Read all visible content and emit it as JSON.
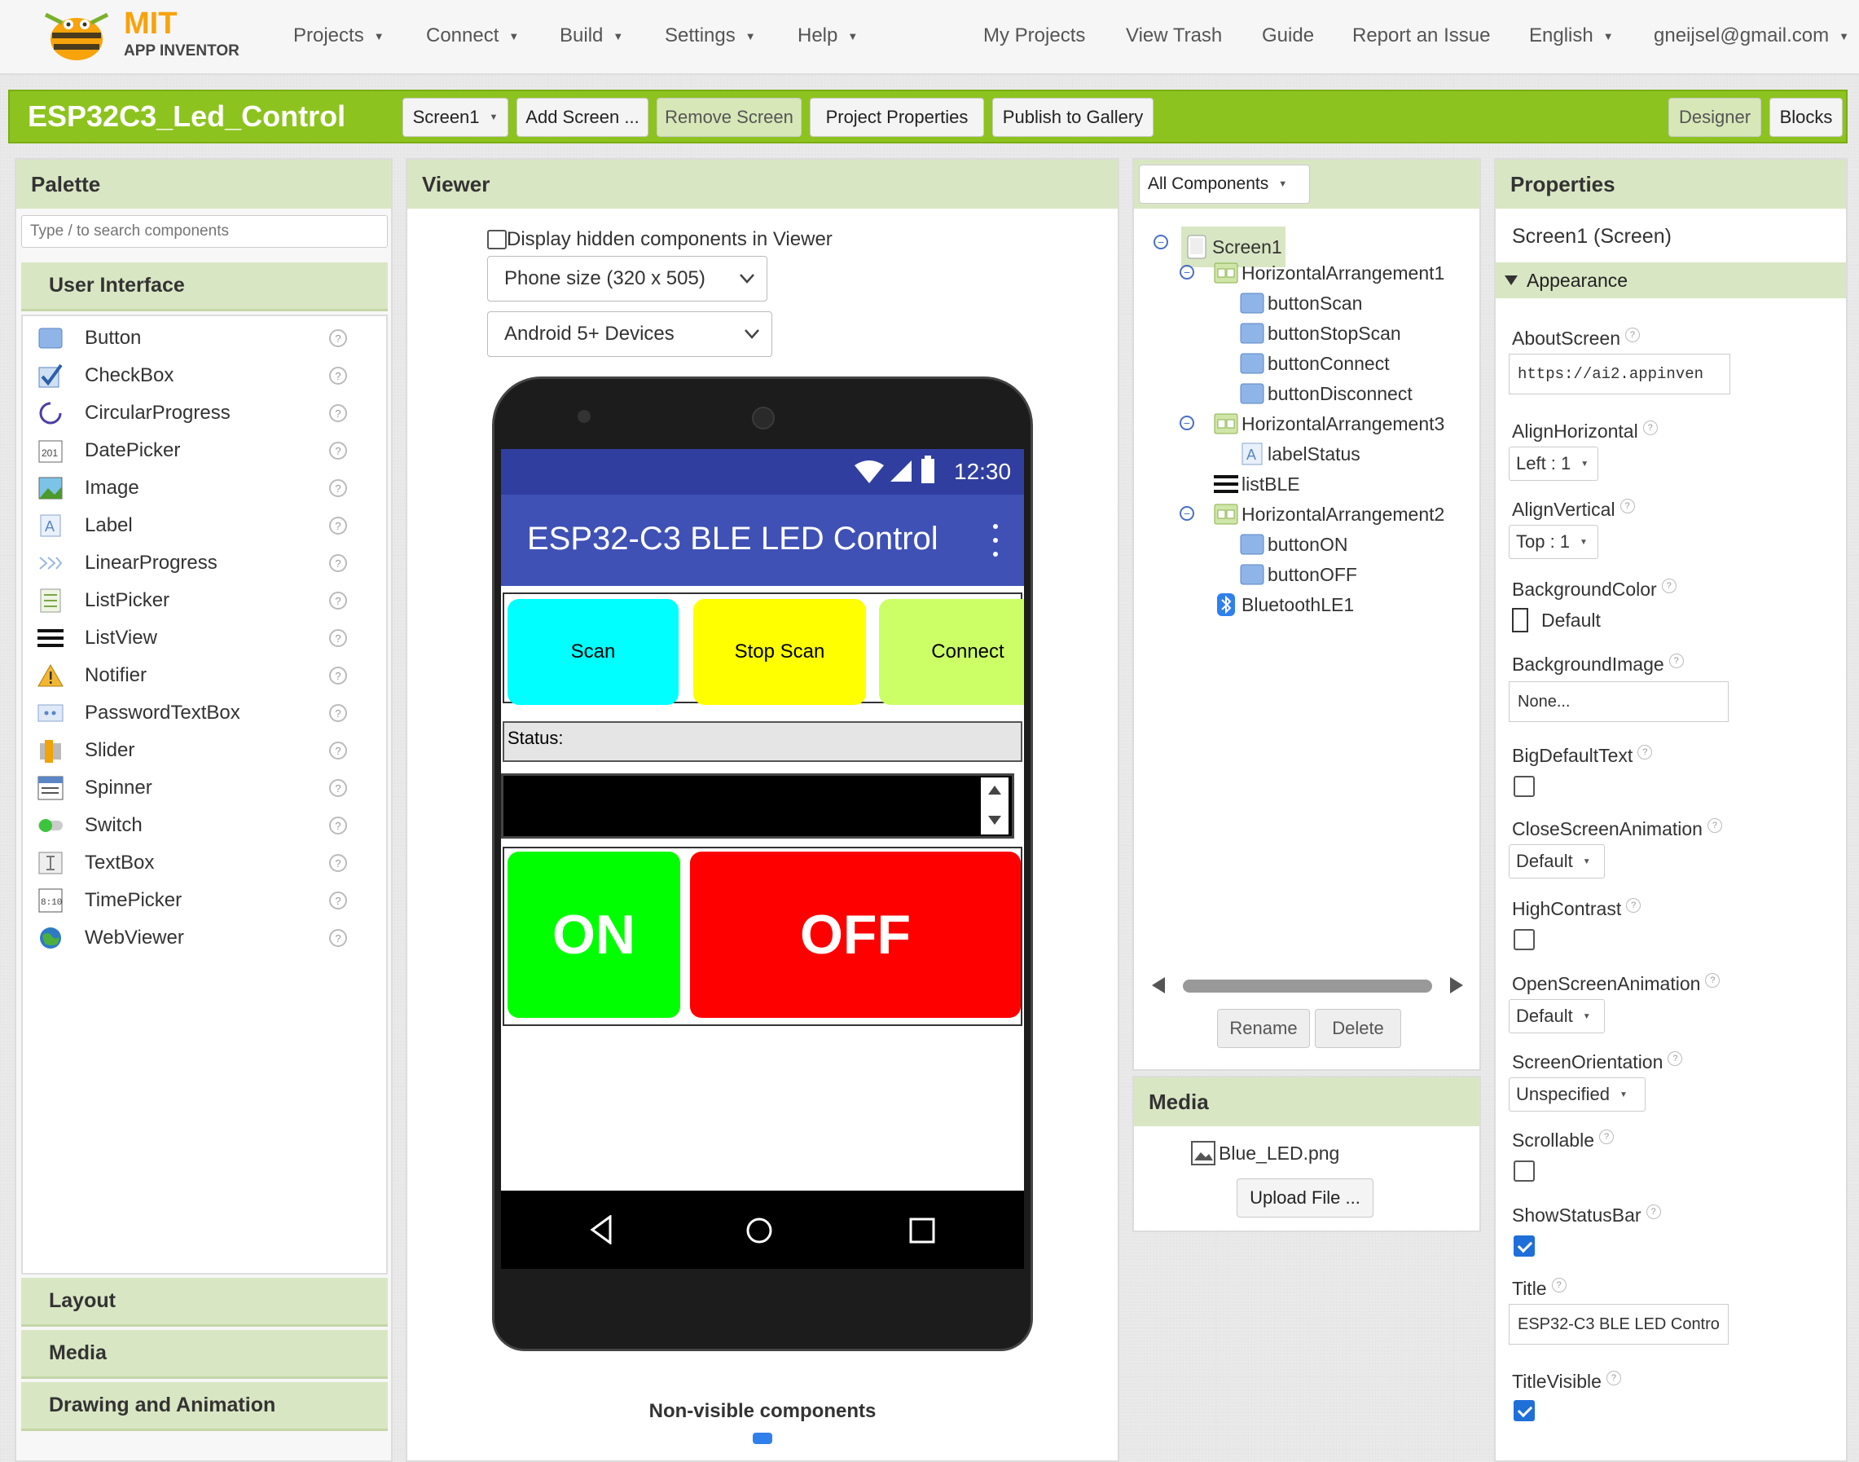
{
  "brand": {
    "mit": "MIT",
    "app_inventor": "APP INVENTOR"
  },
  "nav": {
    "left": [
      {
        "label": "Projects"
      },
      {
        "label": "Connect"
      },
      {
        "label": "Build"
      },
      {
        "label": "Settings"
      },
      {
        "label": "Help"
      }
    ],
    "my_projects": "My Projects",
    "view_trash": "View Trash",
    "guide": "Guide",
    "report": "Report an Issue",
    "language": "English",
    "user": "gneijsel@gmail.com"
  },
  "project": {
    "name": "ESP32C3_Led_Control",
    "screen_select": "Screen1",
    "add_screen": "Add Screen ...",
    "remove_screen": "Remove Screen",
    "properties": "Project Properties",
    "publish": "Publish to Gallery",
    "designer": "Designer",
    "blocks": "Blocks"
  },
  "palette": {
    "title": "Palette",
    "search_placeholder": "Type / to search components",
    "category": "User Interface",
    "items": [
      {
        "label": "Button",
        "icon": "button-icon"
      },
      {
        "label": "CheckBox",
        "icon": "checkbox-icon"
      },
      {
        "label": "CircularProgress",
        "icon": "circular-progress-icon"
      },
      {
        "label": "DatePicker",
        "icon": "calendar-icon"
      },
      {
        "label": "Image",
        "icon": "image-icon"
      },
      {
        "label": "Label",
        "icon": "label-icon"
      },
      {
        "label": "LinearProgress",
        "icon": "linear-progress-icon"
      },
      {
        "label": "ListPicker",
        "icon": "list-picker-icon"
      },
      {
        "label": "ListView",
        "icon": "list-view-icon"
      },
      {
        "label": "Notifier",
        "icon": "warning-icon"
      },
      {
        "label": "PasswordTextBox",
        "icon": "password-icon"
      },
      {
        "label": "Slider",
        "icon": "slider-icon"
      },
      {
        "label": "Spinner",
        "icon": "spinner-icon"
      },
      {
        "label": "Switch",
        "icon": "switch-icon"
      },
      {
        "label": "TextBox",
        "icon": "textbox-icon"
      },
      {
        "label": "TimePicker",
        "icon": "clock-icon"
      },
      {
        "label": "WebViewer",
        "icon": "globe-icon"
      }
    ],
    "help_glyph": "?",
    "more_categories": [
      "Layout",
      "Media",
      "Drawing and Animation"
    ]
  },
  "viewer": {
    "title": "Viewer",
    "display_hidden": "Display hidden components in Viewer",
    "phone_size": "Phone size (320 x 505)",
    "device": "Android 5+ Devices",
    "non_visible": "Non-visible components",
    "phone": {
      "time": "12:30",
      "app_title": "ESP32-C3 BLE LED Control",
      "buttons": {
        "scan": "Scan",
        "stop_scan": "Stop Scan",
        "connect": "Connect",
        "on": "ON",
        "off": "OFF"
      },
      "status_label": "Status:",
      "colors": {
        "statusbar": "#303f9f",
        "titlebar": "#3f51b5",
        "scan": "#00ffff",
        "stop": "#ffff00",
        "connect": "#ccff66",
        "on": "#00ff00",
        "off": "#ff0000"
      }
    }
  },
  "components": {
    "filter": "All Components",
    "tree": [
      {
        "label": "Screen1",
        "depth": 0,
        "icon": "screen-icon",
        "selected": true
      },
      {
        "label": "HorizontalArrangement1",
        "depth": 1,
        "icon": "arrangement-icon"
      },
      {
        "label": "buttonScan",
        "depth": 2,
        "icon": "button-icon"
      },
      {
        "label": "buttonStopScan",
        "depth": 2,
        "icon": "button-icon"
      },
      {
        "label": "buttonConnect",
        "depth": 2,
        "icon": "button-icon"
      },
      {
        "label": "buttonDisconnect",
        "depth": 2,
        "icon": "button-icon"
      },
      {
        "label": "HorizontalArrangement3",
        "depth": 1,
        "icon": "arrangement-icon"
      },
      {
        "label": "labelStatus",
        "depth": 2,
        "icon": "label-icon"
      },
      {
        "label": "listBLE",
        "depth": 1,
        "icon": "list-view-icon"
      },
      {
        "label": "HorizontalArrangement2",
        "depth": 1,
        "icon": "arrangement-icon"
      },
      {
        "label": "buttonON",
        "depth": 2,
        "icon": "button-icon"
      },
      {
        "label": "buttonOFF",
        "depth": 2,
        "icon": "button-icon"
      },
      {
        "label": "BluetoothLE1",
        "depth": 1,
        "icon": "bluetooth-icon"
      }
    ],
    "rename": "Rename",
    "delete": "Delete"
  },
  "media": {
    "title": "Media",
    "file": "Blue_LED.png",
    "upload": "Upload File ..."
  },
  "properties": {
    "title": "Properties",
    "subject": "Screen1 (Screen)",
    "section": "Appearance",
    "about_screen": {
      "label": "AboutScreen",
      "value": "https://ai2.appinven"
    },
    "align_h": {
      "label": "AlignHorizontal",
      "value": "Left : 1"
    },
    "align_v": {
      "label": "AlignVertical",
      "value": "Top : 1"
    },
    "bg_color": {
      "label": "BackgroundColor",
      "value": "Default"
    },
    "bg_image": {
      "label": "BackgroundImage",
      "value": "None..."
    },
    "big_text": {
      "label": "BigDefaultText"
    },
    "close_anim": {
      "label": "CloseScreenAnimation",
      "value": "Default"
    },
    "high_contrast": {
      "label": "HighContrast"
    },
    "open_anim": {
      "label": "OpenScreenAnimation",
      "value": "Default"
    },
    "orientation": {
      "label": "ScreenOrientation",
      "value": "Unspecified"
    },
    "scrollable": {
      "label": "Scrollable"
    },
    "show_status": {
      "label": "ShowStatusBar"
    },
    "title_prop": {
      "label": "Title",
      "value": "ESP32-C3 BLE LED Contro"
    },
    "title_visible": {
      "label": "TitleVisible"
    }
  }
}
